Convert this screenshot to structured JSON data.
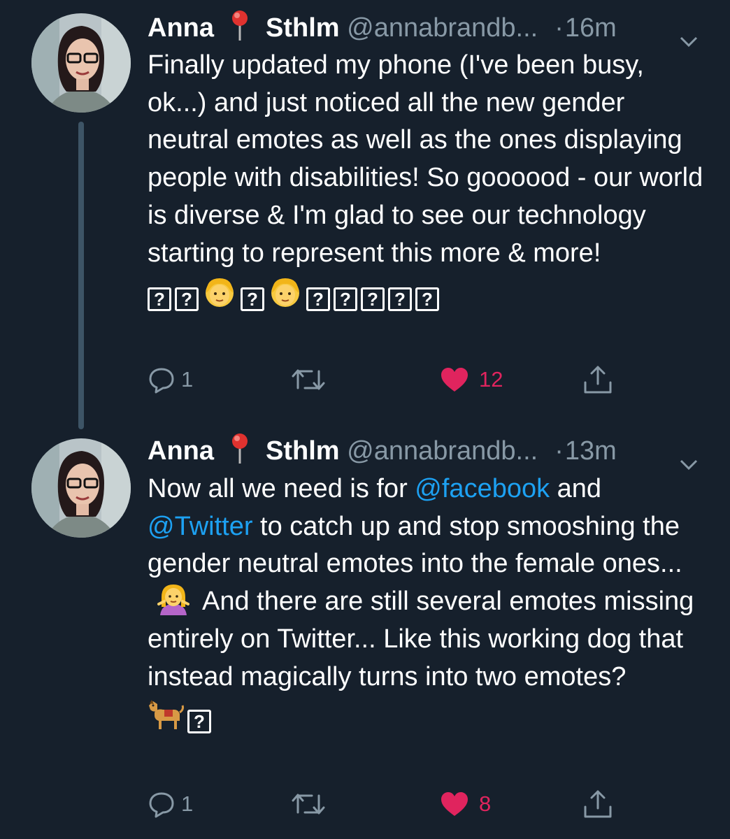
{
  "tweets": [
    {
      "name": "Anna",
      "name_suffix": "Sthlm",
      "handle": "@annabrandb...",
      "time": "16m",
      "text": "Finally updated my phone (I've been busy, ok...) and just noticed all the new gender neutral emotes as well as the ones displaying people with disabilities! So goooood - our world is diverse & I'm glad to see our technology starting to represent this more & more!",
      "emoji_row_glyph": "?",
      "reply_count": "1",
      "like_count": "12"
    },
    {
      "name": "Anna",
      "name_suffix": "Sthlm",
      "handle": "@annabrandb...",
      "time": "13m",
      "text_part1": "Now all we need is for ",
      "mention1": "@facebook",
      "text_part2": " and ",
      "mention2": "@Twitter",
      "text_part3": " to catch up and stop smooshing the gender neutral emotes into the female ones...",
      "text_part4": "And there are still several emotes missing entirely on Twitter... Like this working dog that instead magically turns into two emotes?",
      "emoji_row_glyph": "?",
      "reply_count": "1",
      "like_count": "8"
    }
  ],
  "colors": {
    "background": "#16202c",
    "text": "#ffffff",
    "secondary": "#8899a6",
    "link": "#1da1f2",
    "like": "#e0245e",
    "thread_line": "#3d5466"
  },
  "icons": {
    "pin": "round-pushpin-icon",
    "caret": "chevron-down-icon",
    "reply": "reply-bubble-icon",
    "retweet": "retweet-icon",
    "like": "heart-icon",
    "share": "share-icon"
  }
}
